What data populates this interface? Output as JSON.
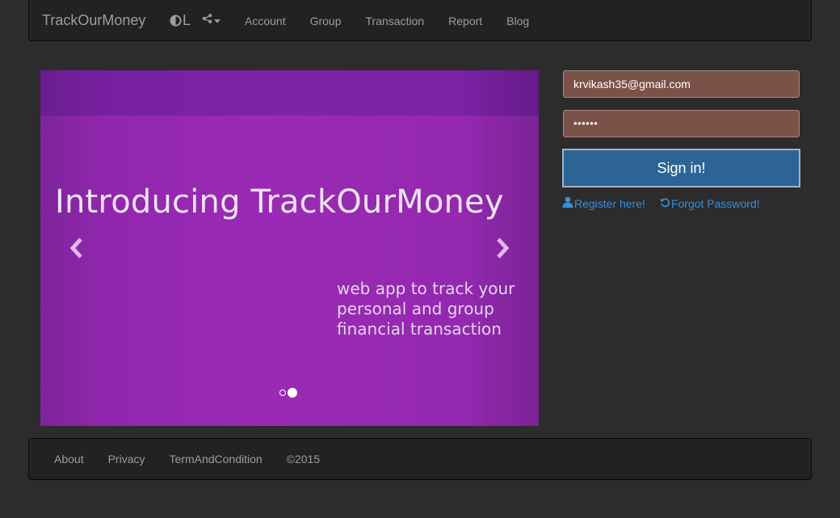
{
  "navbar": {
    "brand": "TrackOurMoney",
    "theme_letter": "L",
    "links": [
      "Account",
      "Group",
      "Transaction",
      "Report",
      "Blog"
    ]
  },
  "carousel": {
    "title": "Introducing TrackOurMoney",
    "subtitle": "web app to track your personal and group financial transaction",
    "slide_count": 2,
    "active_slide": 2
  },
  "login": {
    "email_value": "krvikash35@gmail.com",
    "password_value": "••••••",
    "signin_label": "Sign in!",
    "register_label": "Register here!",
    "forgot_label": "Forgot Password!"
  },
  "footer": {
    "links": [
      "About",
      "Privacy",
      "TermAndCondition"
    ],
    "copyright": "©2015"
  },
  "colors": {
    "navbar_bg": "#222222",
    "page_bg": "#2c2c2c",
    "carousel_purple": "#9a2ab5",
    "input_bg": "#7a5248",
    "signin_bg": "#2c6496",
    "link_blue": "#3a8fd8"
  },
  "icons": {
    "theme": "half-circle-contrast-icon",
    "share": "share-alt-icon",
    "caret": "caret-down-icon",
    "prev": "chevron-left-icon",
    "next": "chevron-right-icon",
    "register": "user-icon",
    "forgot": "refresh-icon"
  }
}
